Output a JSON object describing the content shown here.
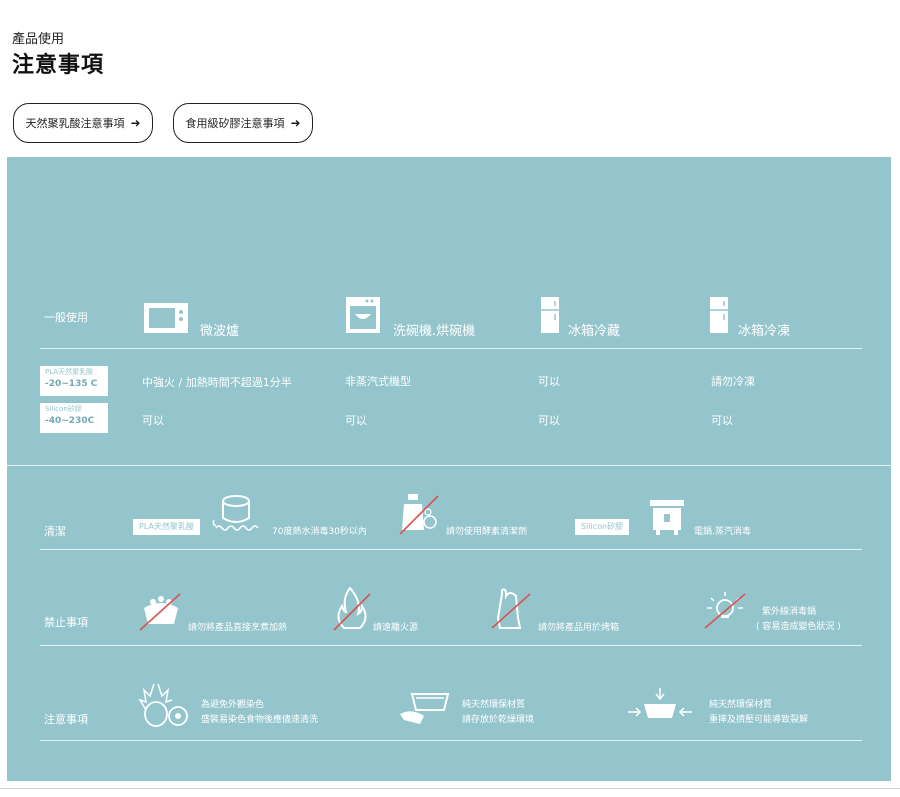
{
  "header": {
    "subtitle": "產品使用",
    "title": "注意事項"
  },
  "buttons": [
    {
      "label": "天然聚乳酸注意事項",
      "arrow": "➜"
    },
    {
      "label": "食用級矽膠注意事項",
      "arrow": "➜"
    }
  ],
  "general": {
    "row_label": "一般使用",
    "columns": [
      "微波爐",
      "洗碗機.烘碗機",
      "冰箱冷藏",
      "冰箱冷凍"
    ],
    "materials": [
      {
        "name": "PLA天然聚乳酸",
        "range": "-20~135 C",
        "values": [
          "中強火 / 加熱時間不超過1分半",
          "非蒸汽式機型",
          "可以",
          "請勿冷凍"
        ]
      },
      {
        "name": "Silicon矽膠",
        "range": "-40~230C",
        "values": [
          "可以",
          "可以",
          "可以",
          "可以"
        ]
      }
    ]
  },
  "cleaning": {
    "row_label": "清潔",
    "pla_tag": "PLA天然聚乳酸",
    "pla_text1": "70度熱水消毒30秒以內",
    "pla_text2": "請勿使用酵素清潔劑",
    "silicon_tag": "Silicon矽膠",
    "silicon_text": "電鍋.蒸汽消毒"
  },
  "prohibited": {
    "row_label": "禁止事項",
    "items": [
      "請勿將產品直接烹煮加熱",
      "請遠離火源",
      "請勿將產品用於烤箱"
    ],
    "uv_line1": "紫外線消毒鍋",
    "uv_line2": "( 容易造成變色狀況 )"
  },
  "notes": {
    "row_label": "注意事項",
    "items": [
      {
        "line1": "為避免外觀染色",
        "line2": "盛裝易染色食物後應儘速清洗"
      },
      {
        "line1": "純天然環保材質",
        "line2": "請存放於乾燥環境"
      },
      {
        "line1": "純天然環保材質",
        "line2": "重摔及擠壓可能導致裂解"
      }
    ]
  },
  "colors": {
    "panel": "#94c5cd",
    "accent_red": "#d9534f",
    "text_dark": "#1f1f1f"
  }
}
